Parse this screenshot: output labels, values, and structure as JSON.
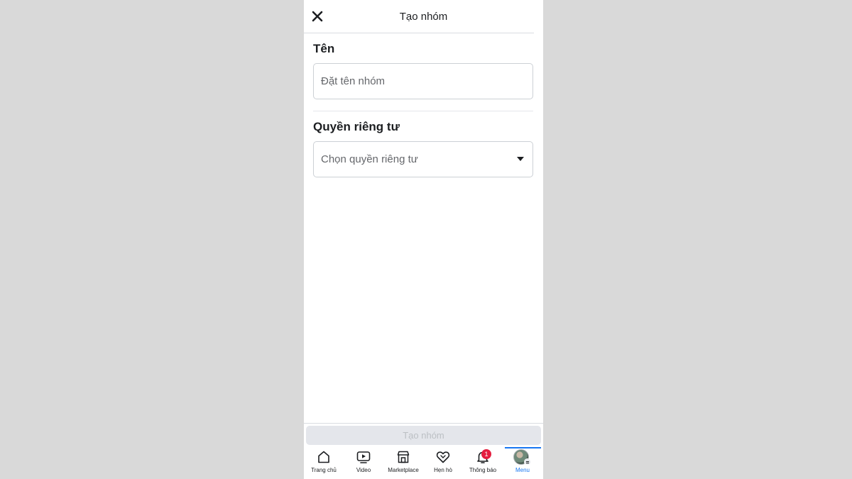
{
  "header": {
    "title": "Tạo nhóm",
    "close_icon": "close-icon"
  },
  "form": {
    "name_label": "Tên",
    "name_placeholder": "Đặt tên nhóm",
    "privacy_label": "Quyền riêng tư",
    "privacy_value": "Chọn quyền riêng tư"
  },
  "actions": {
    "create_label": "Tạo nhóm"
  },
  "tabbar": {
    "tabs": [
      {
        "label": "Trang chủ",
        "icon": "home-icon"
      },
      {
        "label": "Video",
        "icon": "video-icon"
      },
      {
        "label": "Marketplace",
        "icon": "marketplace-icon"
      },
      {
        "label": "Hẹn hò",
        "icon": "dating-heart-icon"
      },
      {
        "label": "Thông báo",
        "icon": "bell-icon",
        "badge": "1"
      },
      {
        "label": "Menu",
        "icon": "avatar",
        "active": true
      }
    ]
  },
  "colors": {
    "accent": "#1877f2",
    "badge": "#e41e3f",
    "disabled_button": "#e4e6eb"
  }
}
